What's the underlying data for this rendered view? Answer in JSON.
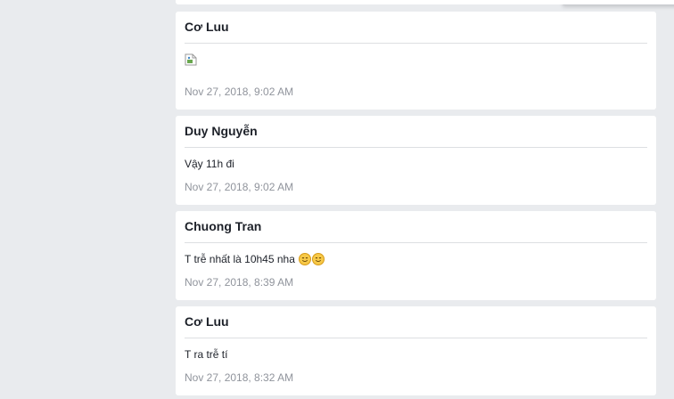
{
  "posts": [
    {
      "author": "Cơ Luu",
      "attachment_icon": "broken-image-icon",
      "timestamp": "Nov 27, 2018, 9:02 AM"
    },
    {
      "author": "Duy Nguyễn",
      "message": "Vậy 11h đi",
      "timestamp": "Nov 27, 2018, 9:02 AM"
    },
    {
      "author": "Chuong Tran",
      "message": "T trễ nhất là 10h45 nha",
      "emoji": [
        "smiling-face-icon",
        "smiling-face-icon"
      ],
      "timestamp": "Nov 27, 2018, 8:39 AM"
    },
    {
      "author": "Cơ Luu",
      "message": "T ra trễ tí",
      "timestamp": "Nov 27, 2018, 8:32 AM"
    }
  ],
  "colors": {
    "page_background": "#e9ebee",
    "card_background": "#ffffff",
    "author_text": "#1d2129",
    "timestamp_text": "#90949c",
    "divider": "#dddfe2",
    "emoji_fill": "#f7c948"
  }
}
